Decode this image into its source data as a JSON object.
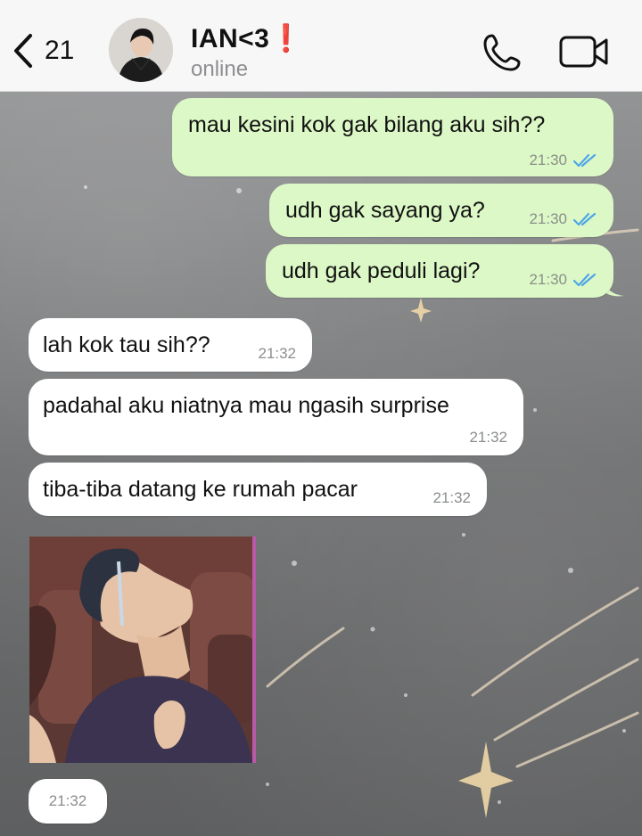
{
  "header": {
    "back_count": "21",
    "contact_name": "IAN<3",
    "name_emoji": "❗",
    "status": "online",
    "icons": [
      "chevron-left-icon",
      "phone-icon",
      "video-camera-icon"
    ]
  },
  "messages": [
    {
      "direction": "outgoing",
      "text": "mau kesini kok gak bilang aku sih??",
      "time": "21:30",
      "read": true
    },
    {
      "direction": "outgoing",
      "text": "udh gak sayang ya?",
      "time": "21:30",
      "read": true
    },
    {
      "direction": "outgoing",
      "text": "udh gak peduli lagi?",
      "time": "21:30",
      "read": true
    },
    {
      "direction": "incoming",
      "text": "lah kok tau sih??",
      "time": "21:32"
    },
    {
      "direction": "incoming",
      "text": "padahal aku niatnya mau ngasih surprise",
      "time": "21:32"
    },
    {
      "direction": "incoming",
      "text": "tiba-tiba datang ke rumah pacar",
      "time": "21:32"
    },
    {
      "direction": "incoming",
      "type": "image",
      "time": "21:32"
    }
  ],
  "colors": {
    "outgoing_bubble": "#dcf8c6",
    "incoming_bubble": "#ffffff",
    "read_ticks": "#4fa6e8",
    "header_bg": "#f7f7f7",
    "exclamation": "#e02424"
  }
}
